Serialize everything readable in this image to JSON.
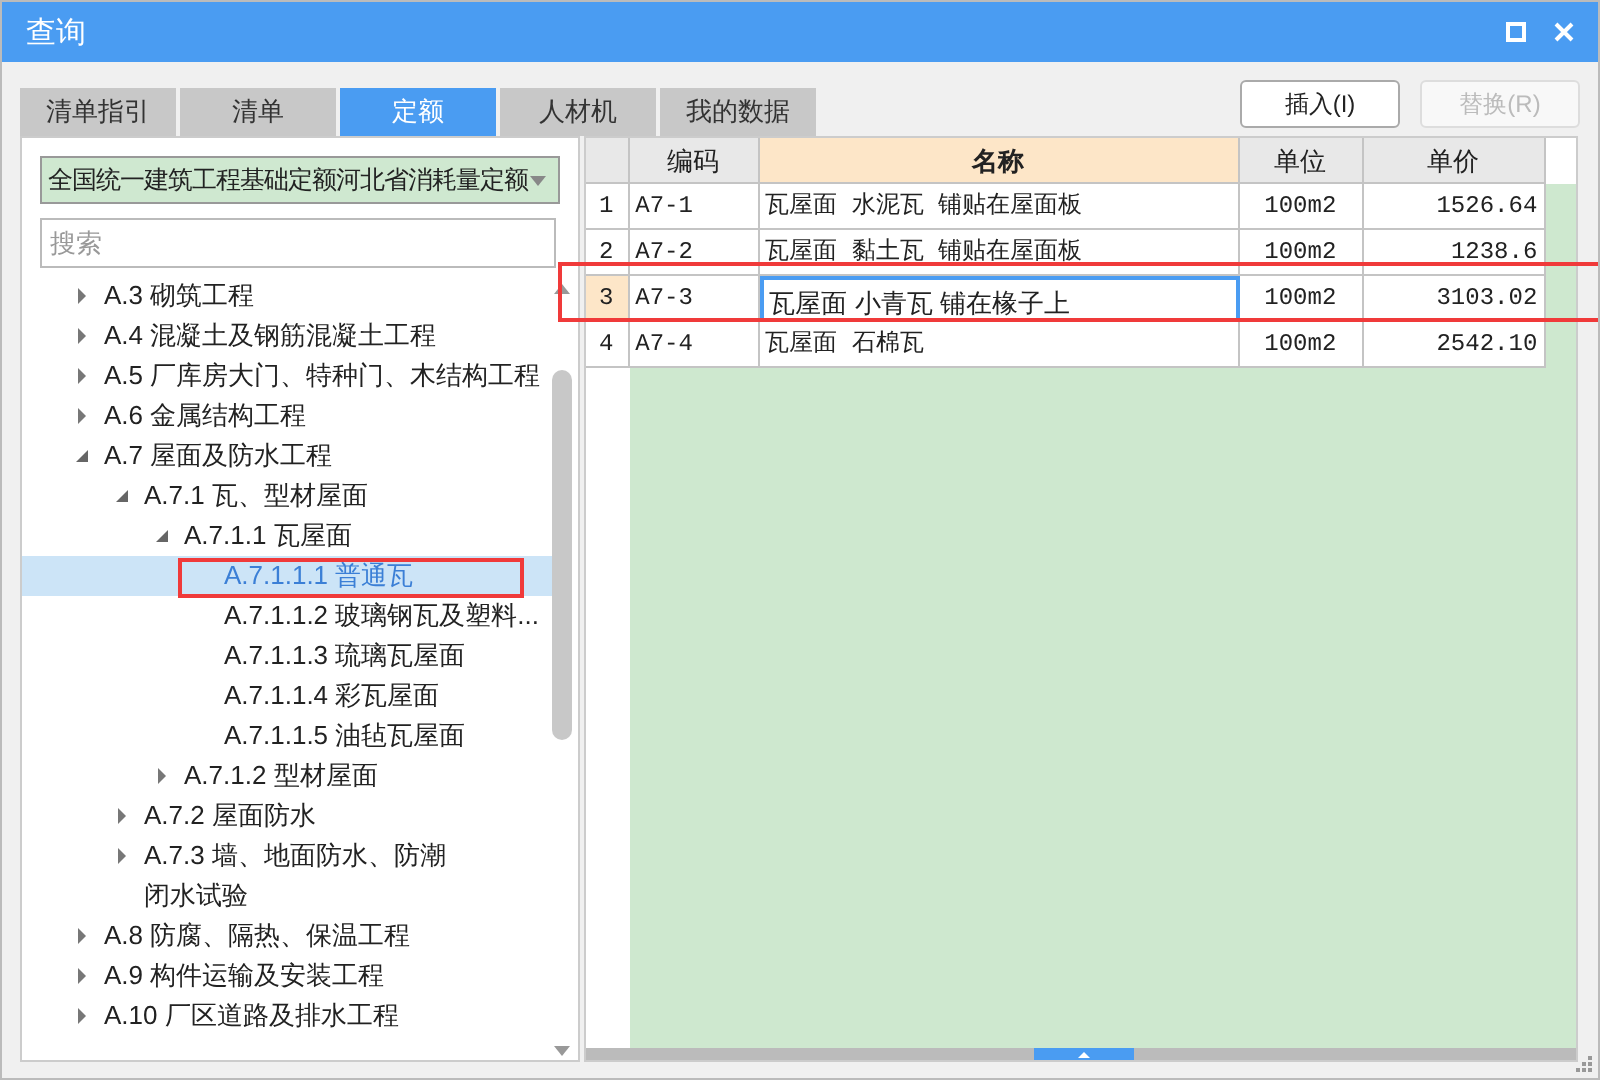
{
  "window": {
    "title": "查询"
  },
  "tabs": [
    {
      "label": "清单指引",
      "selected": false
    },
    {
      "label": "清单",
      "selected": false
    },
    {
      "label": "定额",
      "selected": true
    },
    {
      "label": "人材机",
      "selected": false
    },
    {
      "label": "我的数据",
      "selected": false
    }
  ],
  "buttons": [
    {
      "label": "插入(I)",
      "disabled": false
    },
    {
      "label": "替换(R)",
      "disabled": true
    }
  ],
  "library_select": {
    "value": "全国统一建筑工程基础定额河北省消耗量定额"
  },
  "search": {
    "placeholder": "搜索"
  },
  "tree": [
    {
      "label": "A.3 砌筑工程",
      "kind": "folder",
      "expanded": false,
      "selected": false
    },
    {
      "label": "A.4 混凝土及钢筋混凝土工程",
      "kind": "folder",
      "expanded": false,
      "selected": false
    },
    {
      "label": "A.5 厂库房大门、特种门、木结构工程",
      "kind": "folder",
      "expanded": false,
      "selected": false
    },
    {
      "label": "A.6 金属结构工程",
      "kind": "folder",
      "expanded": false,
      "selected": false
    },
    {
      "label": "A.7 屋面及防水工程",
      "kind": "folder",
      "expanded": true,
      "selected": false,
      "children": [
        {
          "label": "A.7.1 瓦、型材屋面",
          "kind": "folder",
          "expanded": true,
          "selected": false,
          "children": [
            {
              "label": "A.7.1.1 瓦屋面",
              "kind": "folder",
              "expanded": true,
              "selected": false,
              "children": [
                {
                  "label": "A.7.1.1.1 普通瓦",
                  "kind": "leaf",
                  "selected": true
                },
                {
                  "label": "A.7.1.1.2 玻璃钢瓦及塑料...",
                  "kind": "leaf",
                  "selected": false
                },
                {
                  "label": "A.7.1.1.3 琉璃瓦屋面",
                  "kind": "leaf",
                  "selected": false
                },
                {
                  "label": "A.7.1.1.4 彩瓦屋面",
                  "kind": "leaf",
                  "selected": false
                },
                {
                  "label": "A.7.1.1.5 油毡瓦屋面",
                  "kind": "leaf",
                  "selected": false
                }
              ]
            },
            {
              "label": "A.7.1.2 型材屋面",
              "kind": "folder",
              "expanded": false,
              "selected": false
            }
          ]
        },
        {
          "label": "A.7.2 屋面防水",
          "kind": "folder",
          "expanded": false,
          "selected": false
        },
        {
          "label": "A.7.3 墙、地面防水、防潮闭水试验",
          "kind": "folder",
          "expanded": false,
          "selected": false
        }
      ]
    },
    {
      "label": "A.8 防腐、隔热、保温工程",
      "kind": "folder",
      "expanded": false,
      "selected": false
    },
    {
      "label": "A.9 构件运输及安装工程",
      "kind": "folder",
      "expanded": false,
      "selected": false
    },
    {
      "label": "A.10 厂区道路及排水工程",
      "kind": "folder",
      "expanded": false,
      "selected": false
    }
  ],
  "table": {
    "columns": [
      {
        "label": "编码",
        "selected": false
      },
      {
        "label": "名称",
        "selected": true
      },
      {
        "label": "单位",
        "selected": false
      },
      {
        "label": "单价",
        "selected": false
      }
    ],
    "rows": [
      {
        "number": "1",
        "selected": false,
        "cells": [
          "A7-1",
          "瓦屋面 水泥瓦 铺贴在屋面板",
          "100m2",
          "1526.64"
        ]
      },
      {
        "number": "2",
        "selected": false,
        "cells": [
          "A7-2",
          "瓦屋面 黏土瓦 铺贴在屋面板",
          "100m2",
          "1238.6"
        ]
      },
      {
        "number": "3",
        "selected": true,
        "cells": [
          "A7-3",
          "瓦屋面 小青瓦 铺在椽子上",
          "100m2",
          "3103.02"
        ]
      },
      {
        "number": "4",
        "selected": false,
        "cells": [
          "A7-4",
          "瓦屋面 石棉瓦",
          "100m2",
          "2542.10"
        ]
      }
    ]
  }
}
